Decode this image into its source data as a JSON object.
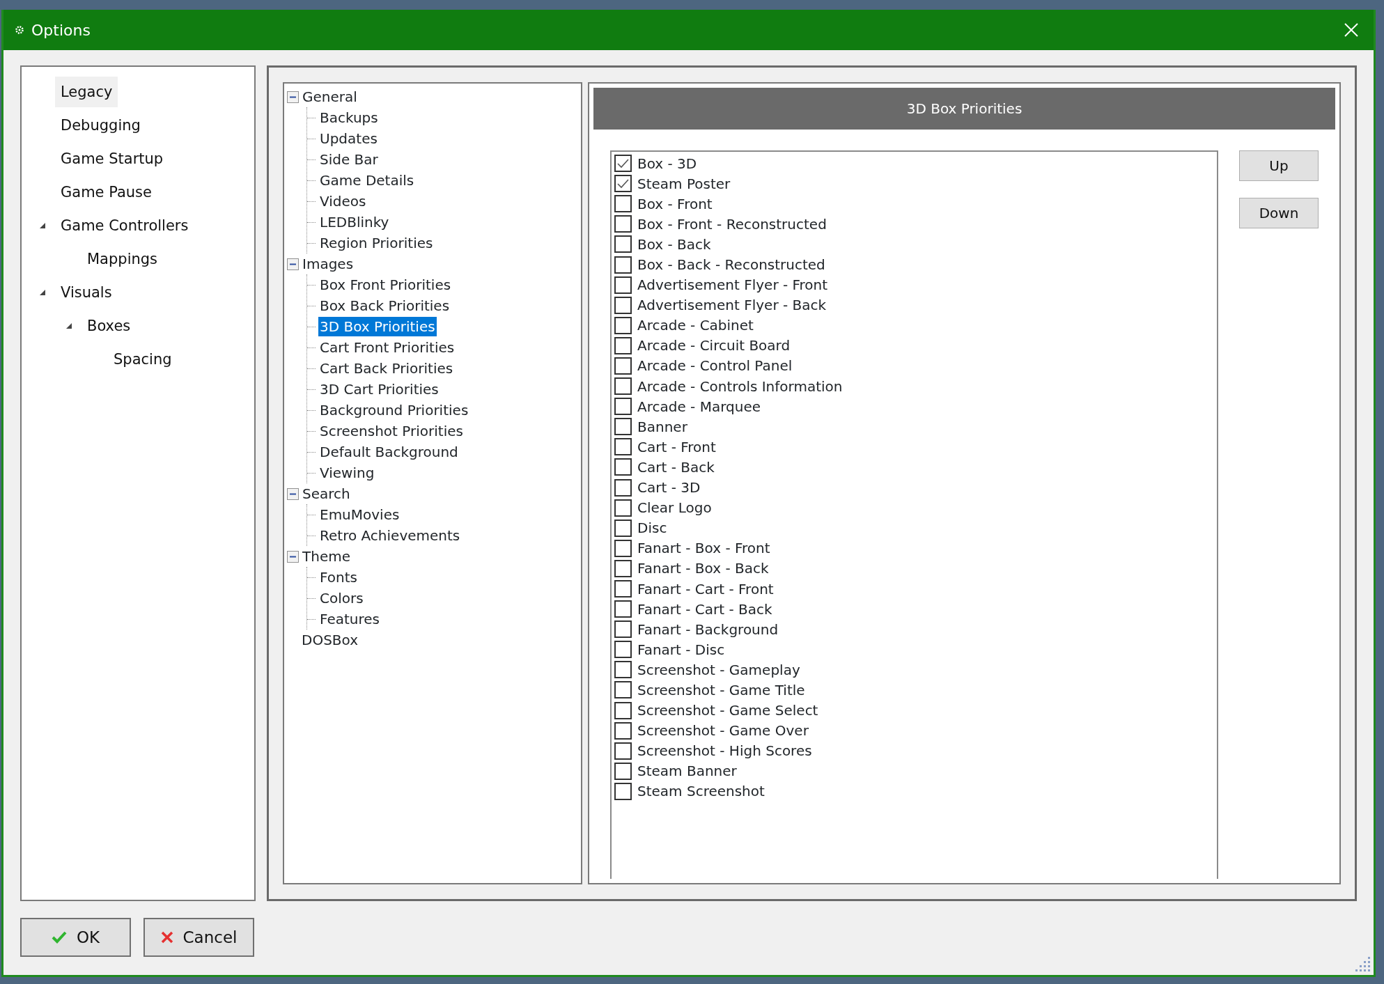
{
  "window": {
    "title": "Options"
  },
  "sidebar": {
    "items": [
      {
        "label": "Legacy",
        "selected": true
      },
      {
        "label": "Debugging",
        "selected": false
      },
      {
        "label": "Game Startup",
        "selected": false
      },
      {
        "label": "Game Pause",
        "selected": false
      },
      {
        "label": "Game Controllers",
        "selected": false,
        "expanded": true,
        "children": [
          {
            "label": "Mappings",
            "selected": false
          }
        ]
      },
      {
        "label": "Visuals",
        "selected": false,
        "expanded": true,
        "children": [
          {
            "label": "Boxes",
            "selected": false,
            "expanded": true,
            "children": [
              {
                "label": "Spacing",
                "selected": false
              }
            ]
          }
        ]
      }
    ]
  },
  "tree": [
    {
      "label": "General",
      "selected": false,
      "expanded": true,
      "children": [
        {
          "label": "Backups",
          "selected": false
        },
        {
          "label": "Updates",
          "selected": false
        },
        {
          "label": "Side Bar",
          "selected": false
        },
        {
          "label": "Game Details",
          "selected": false
        },
        {
          "label": "Videos",
          "selected": false
        },
        {
          "label": "LEDBlinky",
          "selected": false
        },
        {
          "label": "Region Priorities",
          "selected": false
        }
      ]
    },
    {
      "label": "Images",
      "selected": false,
      "expanded": true,
      "children": [
        {
          "label": "Box Front Priorities",
          "selected": false
        },
        {
          "label": "Box Back Priorities",
          "selected": false
        },
        {
          "label": "3D Box Priorities",
          "selected": true
        },
        {
          "label": "Cart Front Priorities",
          "selected": false
        },
        {
          "label": "Cart Back Priorities",
          "selected": false
        },
        {
          "label": "3D Cart Priorities",
          "selected": false
        },
        {
          "label": "Background Priorities",
          "selected": false
        },
        {
          "label": "Screenshot Priorities",
          "selected": false
        },
        {
          "label": "Default Background",
          "selected": false
        },
        {
          "label": "Viewing",
          "selected": false
        }
      ]
    },
    {
      "label": "Search",
      "selected": false,
      "expanded": true,
      "children": [
        {
          "label": "EmuMovies",
          "selected": false
        },
        {
          "label": "Retro Achievements",
          "selected": false
        }
      ]
    },
    {
      "label": "Theme",
      "selected": false,
      "expanded": true,
      "children": [
        {
          "label": "Fonts",
          "selected": false
        },
        {
          "label": "Colors",
          "selected": false
        },
        {
          "label": "Features",
          "selected": false
        }
      ]
    },
    {
      "label": "DOSBox",
      "selected": false
    }
  ],
  "panel": {
    "title": "3D Box Priorities",
    "items": [
      {
        "label": "Box - 3D",
        "checked": true
      },
      {
        "label": "Steam Poster",
        "checked": true
      },
      {
        "label": "Box - Front",
        "checked": false
      },
      {
        "label": "Box - Front - Reconstructed",
        "checked": false
      },
      {
        "label": "Box - Back",
        "checked": false
      },
      {
        "label": "Box - Back - Reconstructed",
        "checked": false
      },
      {
        "label": "Advertisement Flyer - Front",
        "checked": false
      },
      {
        "label": "Advertisement Flyer - Back",
        "checked": false
      },
      {
        "label": "Arcade - Cabinet",
        "checked": false
      },
      {
        "label": "Arcade - Circuit Board",
        "checked": false
      },
      {
        "label": "Arcade - Control Panel",
        "checked": false
      },
      {
        "label": "Arcade - Controls Information",
        "checked": false
      },
      {
        "label": "Arcade - Marquee",
        "checked": false
      },
      {
        "label": "Banner",
        "checked": false
      },
      {
        "label": "Cart - Front",
        "checked": false
      },
      {
        "label": "Cart - Back",
        "checked": false
      },
      {
        "label": "Cart - 3D",
        "checked": false
      },
      {
        "label": "Clear Logo",
        "checked": false
      },
      {
        "label": "Disc",
        "checked": false
      },
      {
        "label": "Fanart - Box - Front",
        "checked": false
      },
      {
        "label": "Fanart - Box - Back",
        "checked": false
      },
      {
        "label": "Fanart - Cart - Front",
        "checked": false
      },
      {
        "label": "Fanart - Cart - Back",
        "checked": false
      },
      {
        "label": "Fanart - Background",
        "checked": false
      },
      {
        "label": "Fanart - Disc",
        "checked": false
      },
      {
        "label": "Screenshot - Gameplay",
        "checked": false
      },
      {
        "label": "Screenshot - Game Title",
        "checked": false
      },
      {
        "label": "Screenshot - Game Select",
        "checked": false
      },
      {
        "label": "Screenshot - Game Over",
        "checked": false
      },
      {
        "label": "Screenshot - High Scores",
        "checked": false
      },
      {
        "label": "Steam Banner",
        "checked": false
      },
      {
        "label": "Steam Screenshot",
        "checked": false
      }
    ],
    "buttons": [
      "Up",
      "Down"
    ]
  },
  "footer_buttons": [
    {
      "kind": "ok",
      "label": "OK"
    },
    {
      "kind": "cancel",
      "label": "Cancel"
    }
  ]
}
